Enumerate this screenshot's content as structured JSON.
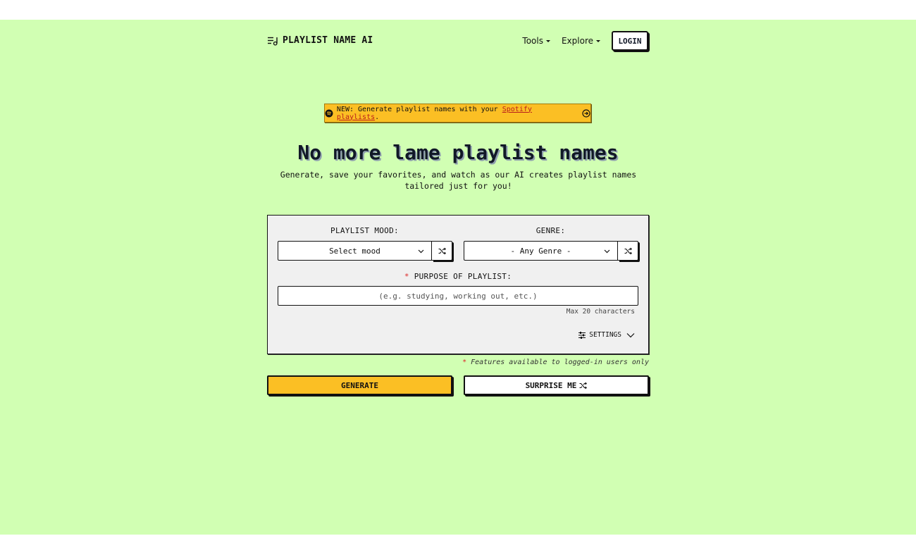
{
  "header": {
    "logo_text": "PLAYLIST NAME AI",
    "logo_icon": "playlist-icon",
    "nav": [
      {
        "label": "Tools"
      },
      {
        "label": "Explore"
      }
    ],
    "login_label": "LOGIN"
  },
  "banner": {
    "prefix": "NEW: Generate playlist names with your ",
    "link": "Spotify playlists",
    "suffix": ".",
    "icon": "spotify-icon",
    "arrow_icon": "arrow-right-circle-icon"
  },
  "hero": {
    "title": "No more lame playlist names",
    "subtitle": "Generate, save your favorites, and watch as our AI creates playlist names tailored just for you!"
  },
  "form": {
    "mood_label": "PLAYLIST MOOD:",
    "mood_value": "Select mood",
    "genre_label": "GENRE:",
    "genre_value": "- Any Genre -",
    "purpose_required": "*",
    "purpose_label": "PURPOSE OF PLAYLIST:",
    "purpose_placeholder": "(e.g. studying, working out, etc.)",
    "purpose_hint": "Max 20 characters",
    "settings_label": "SETTINGS"
  },
  "note": {
    "asterisk": "*",
    "text": "Features available to logged-in users only"
  },
  "buttons": {
    "generate": "GENERATE",
    "surprise": "SURPRISE ME"
  },
  "colors": {
    "background": "#d1ffb3",
    "accent": "#fbbf24",
    "required": "#dc2626",
    "card": "#f0f0f0"
  }
}
